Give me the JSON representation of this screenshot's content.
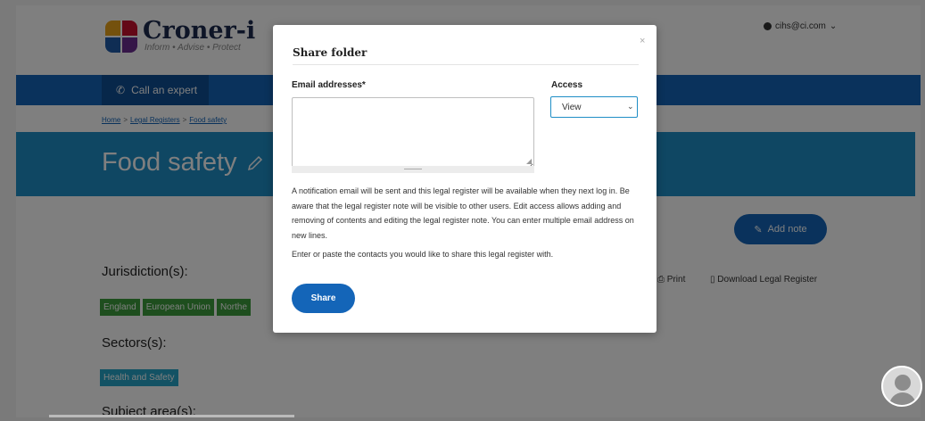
{
  "header": {
    "logo_title": "Croner-i",
    "logo_tagline": "Inform • Advise • Protect",
    "user_email": "cihs@ci.com"
  },
  "nav": {
    "call_expert": "Call an expert"
  },
  "breadcrumb": [
    "Home",
    "Legal Registers",
    "Food safety"
  ],
  "page": {
    "title": "Food safety",
    "add_note": "Add note",
    "jurisdiction_label": "Jurisdiction(s):",
    "jurisdictions": [
      "England",
      "European Union",
      "Northe"
    ],
    "sectors_label": "Sectors(s):",
    "sectors": [
      "Health and Safety"
    ],
    "subject_label": "Subject area(s):",
    "print": "Print",
    "download": "Download Legal Register"
  },
  "modal": {
    "title": "Share folder",
    "close": "×",
    "email_label": "Email addresses*",
    "email_value": "",
    "access_label": "Access",
    "access_value": "View",
    "notice": "A notification email will be sent and this legal register will be available when they next log in. Be aware that the legal register note will be visible to other users. Edit access allows adding and removing of contents and editing the legal register note. You can enter multiple email address on new lines.",
    "instruction": "Enter or paste the contacts you would like to share this legal register with.",
    "share_button": "Share"
  },
  "icons": {
    "user": "user-circle-icon",
    "phone": "phone-icon",
    "edit": "pencil-icon",
    "note": "note-edit-icon",
    "print": "printer-icon",
    "download": "document-icon",
    "chevron": "chevron-down-icon",
    "avatar": "avatar-icon"
  },
  "colors": {
    "brand_blue": "#1465b8",
    "title_band": "#1f8ec6",
    "tag_green": "#3c9d3c",
    "tag_blue": "#27a5c8"
  }
}
